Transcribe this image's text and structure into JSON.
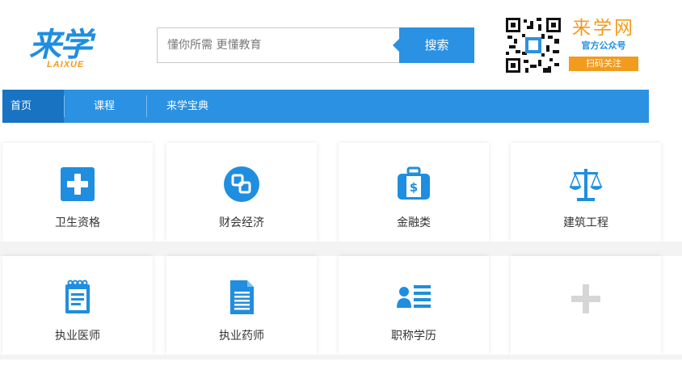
{
  "header": {
    "logo_text": "来学",
    "logo_sub": "LAIXUE",
    "search_placeholder": "懂你所需 更懂教育",
    "search_button": "搜索",
    "brand_name": "来学网",
    "brand_tagline": "官方公众号",
    "scan_label": "扫码关注"
  },
  "nav": {
    "items": [
      {
        "label": "首页",
        "active": true
      },
      {
        "label": "课程",
        "active": false
      },
      {
        "label": "来学宝典",
        "active": false
      }
    ]
  },
  "categories": [
    {
      "label": "卫生资格",
      "icon": "medical-cross-icon"
    },
    {
      "label": "财会经济",
      "icon": "finance-coin-icon"
    },
    {
      "label": "金融类",
      "icon": "money-bag-icon"
    },
    {
      "label": "建筑工程",
      "icon": "scales-icon"
    },
    {
      "label": "执业医师",
      "icon": "notepad-icon"
    },
    {
      "label": "执业药师",
      "icon": "document-icon"
    },
    {
      "label": "职称学历",
      "icon": "profile-card-icon"
    },
    {
      "label": "",
      "icon": "add-plus-icon"
    }
  ],
  "colors": {
    "primary": "#2b91e2",
    "nav_active": "#1873c2",
    "accent_orange": "#f29b1d",
    "icon_blue": "#1f8ee0"
  }
}
